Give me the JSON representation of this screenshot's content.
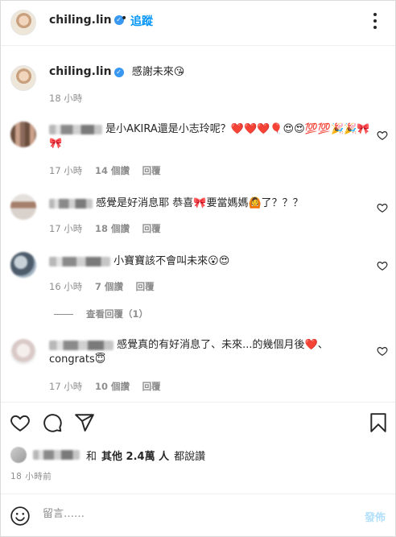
{
  "header": {
    "username": "chiling.lin",
    "separator": "•",
    "follow_label": "追蹤"
  },
  "caption": {
    "username": "chiling.lin",
    "text": "感謝未來😘",
    "time": "18 小時"
  },
  "comments": [
    {
      "text": "是小AKIRA還是小志玲呢？❤️❤️❤️🎈😍😍💯💯🎉🎉🎀🎀",
      "time": "17 小時",
      "likes": "14 個讚",
      "reply": "回覆"
    },
    {
      "text": "感覺是好消息耶 恭喜🎀要當媽媽🙆了？？？",
      "time": "17 小時",
      "likes": "18 個讚",
      "reply": "回覆"
    },
    {
      "text": "小寶寶該不會叫未來😮😍",
      "time": "16 小時",
      "likes": "7 個讚",
      "reply": "回覆"
    },
    {
      "text": "感覺真的有好消息了、未來...的幾個月後❤️、congrats😇",
      "time": "17 小時",
      "likes": "10 個讚",
      "reply": "回覆"
    }
  ],
  "view_replies": "查看回覆（1）",
  "likes_summary": {
    "prefix": "和",
    "others_label": "其他 2.4萬 人",
    "suffix": "都說讚"
  },
  "post_time": "18 小時前",
  "comment_box": {
    "placeholder": "留言……",
    "post_label": "發佈"
  },
  "icons": [
    "more-icon",
    "heart-icon",
    "comment-icon",
    "share-icon",
    "bookmark-icon",
    "smile-icon",
    "verified-icon"
  ],
  "colors": {
    "link_blue": "#0095f6",
    "verified_blue": "#3897f0",
    "muted": "#8e8e8e",
    "post_disabled": "#b2dffc"
  }
}
